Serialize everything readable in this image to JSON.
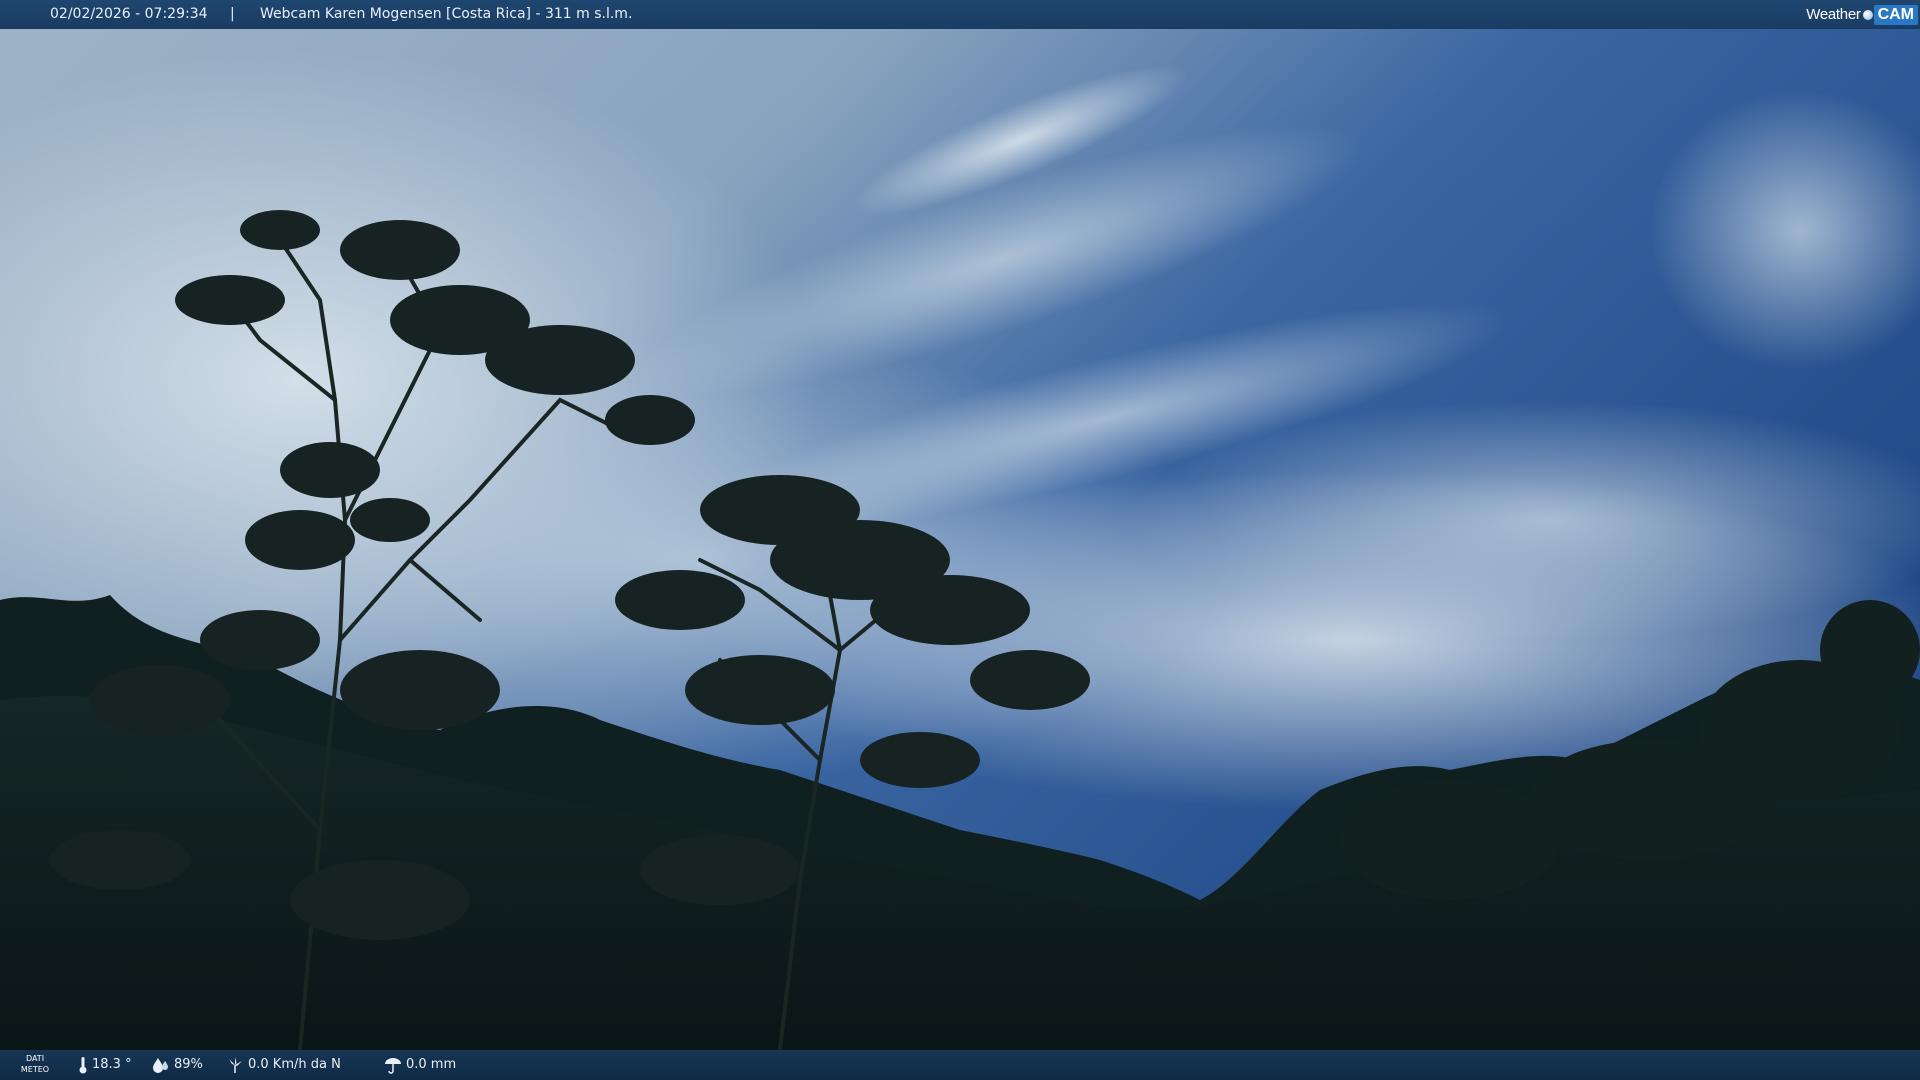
{
  "topbar": {
    "datetime": "02/02/2026 - 07:29:34",
    "separator": "|",
    "title": "Webcam Karen Mogensen [Costa Rica]  - 311 m s.l.m."
  },
  "logo": {
    "weather_text": "Weather",
    "cam_text": "CAM"
  },
  "weather": {
    "dati_label_1": "DATI",
    "dati_label_2": "METEO",
    "temperature": "18.3 °",
    "humidity": "89%",
    "wind": "0.0 Km/h da N",
    "rain": "0.0 mm",
    "icons": [
      "thermometer-icon",
      "humidity-icon",
      "wind-icon",
      "rain-icon"
    ]
  },
  "colors": {
    "bar": "#1a3c63",
    "sky_top": "#1e4a85",
    "foliage": "#0e1c1c"
  }
}
